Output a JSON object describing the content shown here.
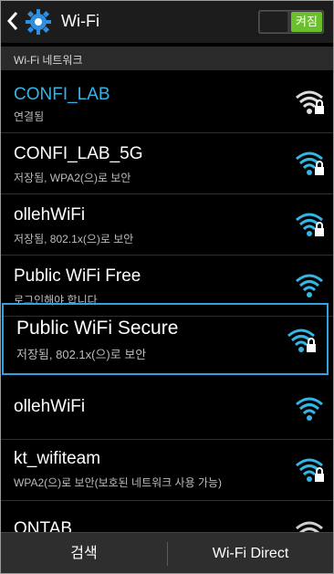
{
  "header": {
    "title": "Wi-Fi",
    "toggle_label": "켜짐"
  },
  "section": {
    "label": "Wi-Fi 네트워크"
  },
  "networks": [
    {
      "name": "CONFI_LAB",
      "status": "연결됨",
      "secured": true,
      "connected": true
    },
    {
      "name": "CONFI_LAB_5G",
      "status": "저장됨, WPA2(으)로 보안",
      "secured": true
    },
    {
      "name": "ollehWiFi",
      "status": "저장됨, 802.1x(으)로 보안",
      "secured": true
    },
    {
      "name": "Public WiFi Free",
      "status": "로그인해야 합니다",
      "secured": false
    },
    {
      "name": "Public WiFi Secure",
      "status": "저장됨, 802.1x(으)로 보안",
      "secured": true,
      "selected": true
    },
    {
      "name": "ollehWiFi",
      "status": "",
      "secured": false
    },
    {
      "name": "kt_wifiteam",
      "status": "WPA2(으)로 보안(보호된 네트워크 사용 가능)",
      "secured": true
    },
    {
      "name": "ONTAB",
      "status": "",
      "secured": true
    }
  ],
  "bottom": {
    "search_label": "검색",
    "direct_label": "Wi-Fi Direct"
  },
  "colors": {
    "accent": "#33a0e6",
    "connected_text": "#33b5e5",
    "toggle_on": "#6bbf2a"
  }
}
